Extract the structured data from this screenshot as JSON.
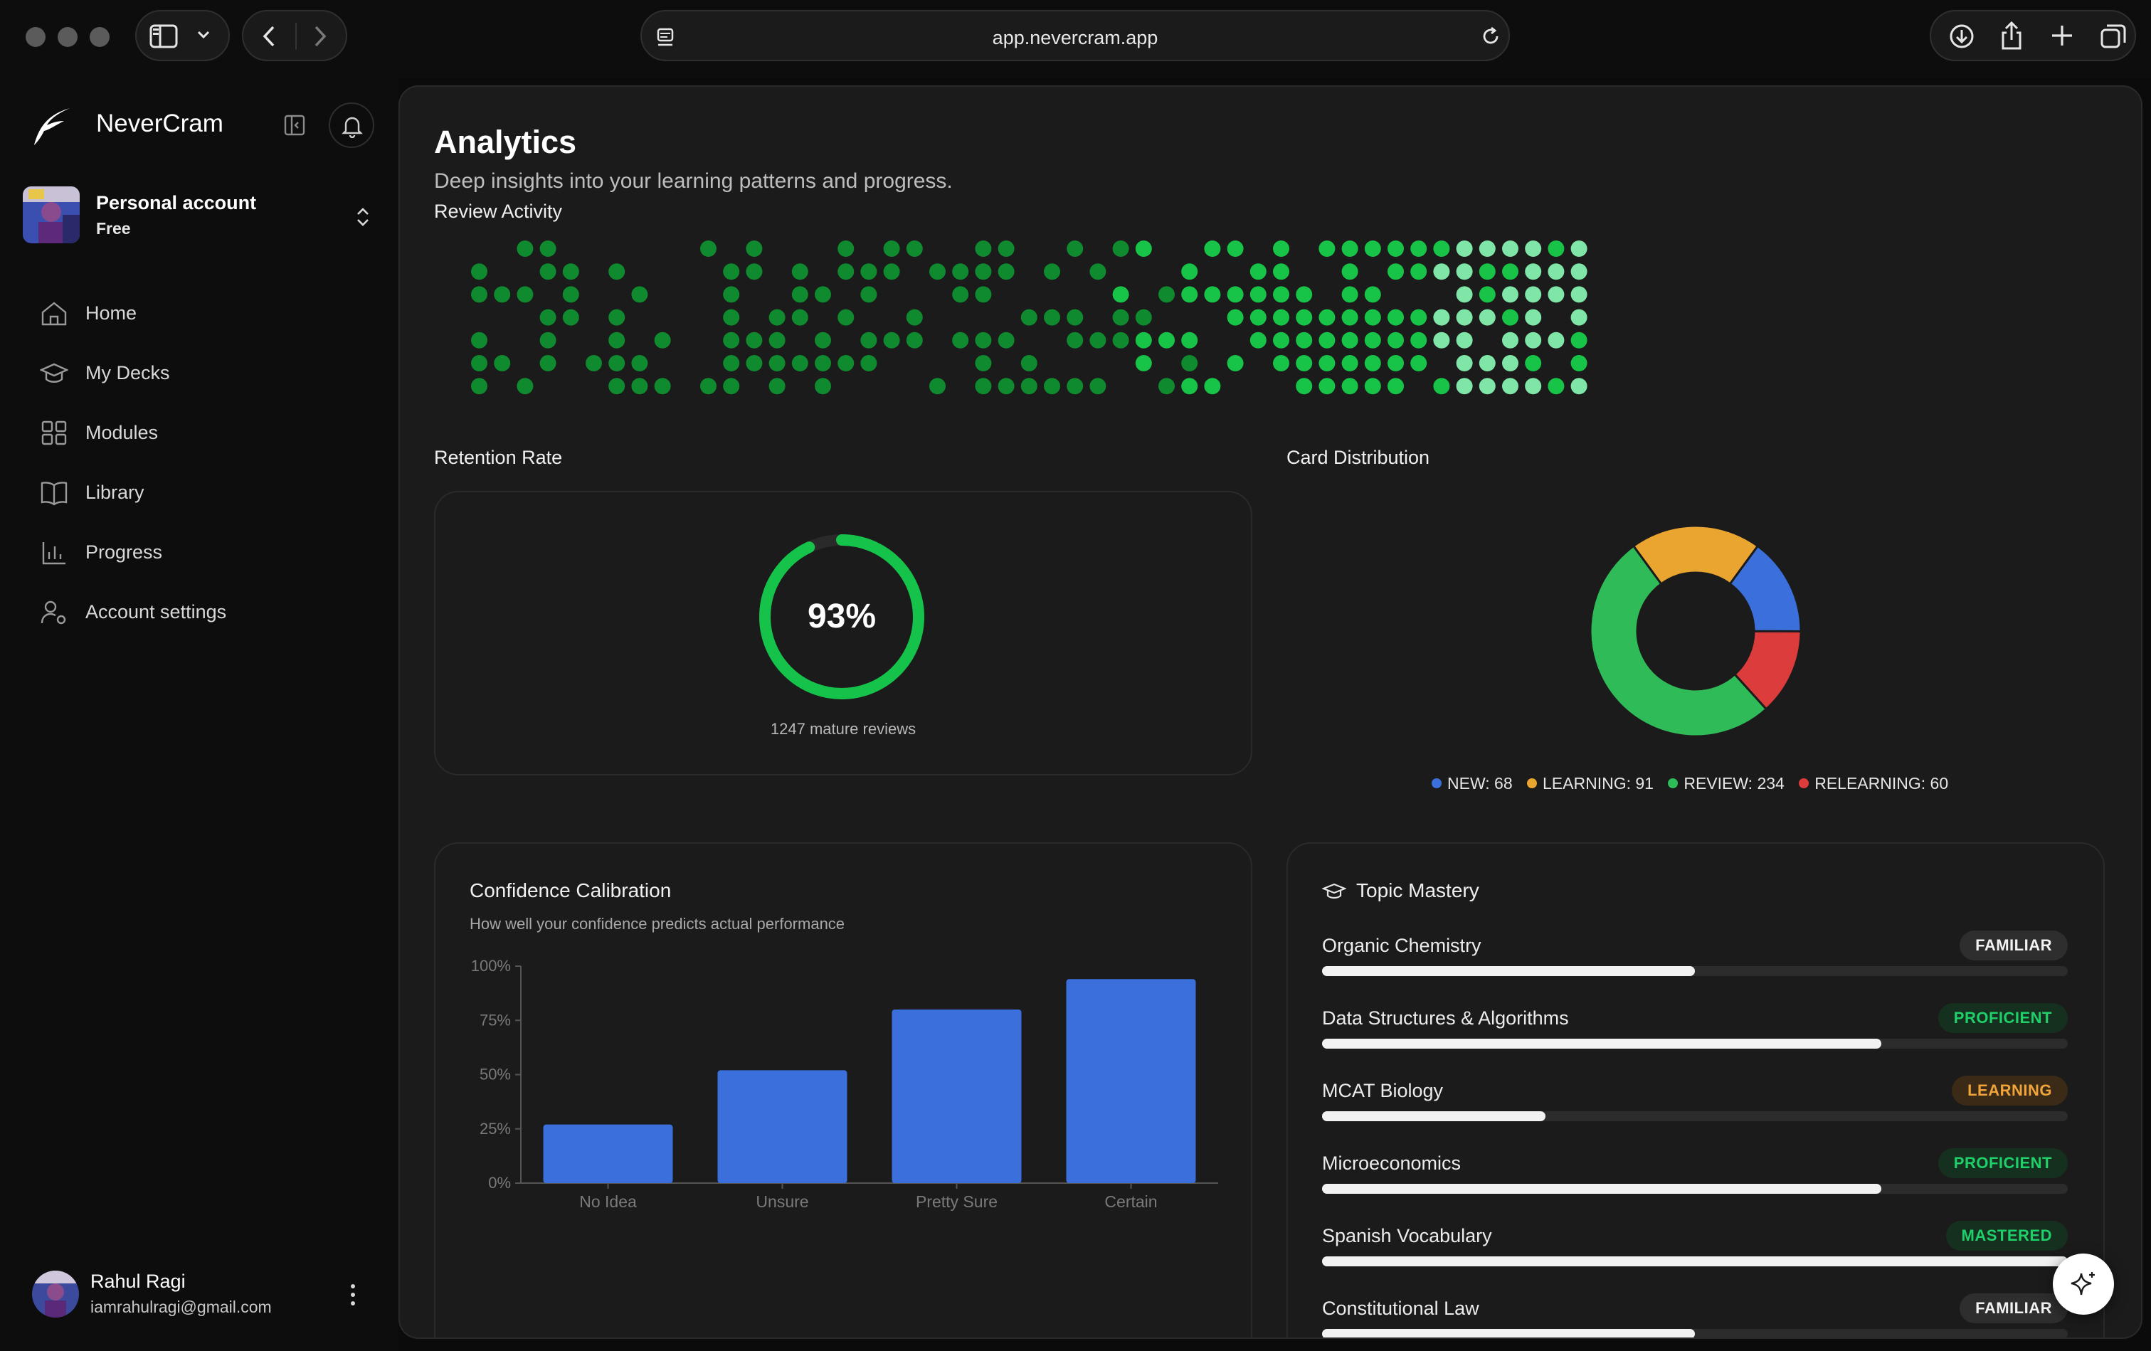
{
  "browser": {
    "url": "app.nevercram.app"
  },
  "sidebar": {
    "brand": "NeverCram",
    "account": {
      "name": "Personal account",
      "plan": "Free"
    },
    "nav": [
      {
        "label": "Home",
        "icon": "home-icon"
      },
      {
        "label": "My Decks",
        "icon": "graduation-cap-icon"
      },
      {
        "label": "Modules",
        "icon": "grid-icon"
      },
      {
        "label": "Library",
        "icon": "book-icon"
      },
      {
        "label": "Progress",
        "icon": "bar-chart-icon"
      },
      {
        "label": "Account settings",
        "icon": "user-settings-icon"
      }
    ],
    "user": {
      "name": "Rahul Ragi",
      "email": "iamrahulragi@gmail.com"
    }
  },
  "page": {
    "title": "Analytics",
    "subtitle": "Deep insights into your learning patterns and progress."
  },
  "review_activity": {
    "label": "Review Activity",
    "colors": [
      "#0f8a2e",
      "#17c447",
      "#7fe6a8"
    ],
    "weeks": [
      "0000000",
      "0000000",
      "0000000",
      "0001011",
      "0000000",
      "0010011",
      "0000110",
      "0001001",
      "1000000",
      "0100000",
      "0000000",
      "0000011",
      "0000000",
      "0101000",
      "0000101",
      "0000100",
      "0101000",
      "0000000",
      "0000011",
      "0000000",
      "0000000",
      "0000000",
      "0000000",
      "0000000",
      "0000011",
      "0001100",
      "0001011",
      "0000000",
      "0000001",
      "0010000",
      "0000001",
      "0001001",
      "0100011",
      "0000001",
      "0111001",
      "0110111",
      "0000001",
      "0001101",
      "0000011",
      "0101001",
      "0000101",
      "0001001",
      "0101001",
      "0100011",
      "0000101",
      "0000001",
      "0000111",
      "0011001",
      "0000000",
      "0011101",
      "0000001",
      "0010011",
      "0001100",
      "0000011",
      "0000001",
      "0000001",
      "0000111",
      "0101001",
      "0001101",
      "0000011",
      "0010101",
      "0101111",
      "0001011",
      "0011111",
      "0000011",
      "0000001",
      "0011101",
      "0011011",
      "0000111",
      "0000011",
      "0011111",
      "0000011",
      "0011011",
      "0000111",
      "0000011",
      "0011011",
      "0111101",
      "0000101",
      "0001011",
      "0001111",
      "0000011",
      "0000101",
      "0001011",
      "0000011",
      "0001011",
      "0001111",
      "0000011",
      "0000111",
      "0000011",
      "0010011",
      "0000111",
      "0010011",
      "0001111",
      "0000111",
      "0001111",
      "0000011",
      "0000111",
      "0001111",
      "0011111",
      "0000001",
      "0001111",
      "0010001",
      "0000001",
      "0000011",
      "0000111",
      "0000011",
      "0000011",
      "0001111",
      "0000011",
      "0000000",
      "0000000",
      "0000000",
      "0000000",
      "0000000",
      "0000000",
      "0000000",
      "0000000",
      "0000000",
      "0000000",
      "0000000",
      "0000000",
      "0000000",
      "0000000",
      "0000000",
      "0000000",
      "0000000",
      "0000000",
      "0000000"
    ],
    "intensity": [
      "1111111",
      "1111111",
      "1111111",
      "1111111",
      "1111111",
      "1111111",
      "1111111",
      "1111111",
      "1111111",
      "1111111",
      "1111111",
      "1111111",
      "1111111",
      "1111111",
      "1111111",
      "1111111",
      "1111111",
      "1111111",
      "1111111",
      "1111111",
      "1111111",
      "1111111",
      "1111111",
      "1111111",
      "1111111",
      "1111111",
      "1111111",
      "1111111",
      "1111111",
      "1111111",
      "1111111",
      "1111111",
      "1111111",
      "1111111",
      "1111111",
      "1111111",
      "1111111",
      "1111111",
      "1111111",
      "1111111",
      "1111111",
      "1111111",
      "1111111",
      "1111111",
      "1111111",
      "1111111",
      "1111111",
      "1111111",
      "1111111",
      "1111111",
      "1111111",
      "1111111",
      "1111111",
      "1111111",
      "1111111",
      "1111111",
      "1111111",
      "1111111",
      "1111111",
      "1111111",
      "1111111",
      "1111111",
      "1111111",
      "1111111",
      "1111111",
      "1111111",
      "1111111",
      "1111111",
      "1111111",
      "1111111",
      "1111111",
      "1111111",
      "1111111",
      "1111111",
      "1111111",
      "1111111",
      "1111111",
      "1111111",
      "1111111",
      "1111111",
      "1111111",
      "1111111",
      "1111111",
      "1111111",
      "1111111",
      "1111111",
      "1111111",
      "1111111",
      "1111111",
      "1111111",
      "1111111",
      "1111111",
      "1111111",
      "1111111",
      "1111111",
      "1111111",
      "1111111",
      "1111111",
      "1111111",
      "1111111",
      "1111111",
      "1111111",
      "1111111",
      "1111111",
      "1111111",
      "1111111",
      "1111111",
      "1111111",
      "1111111",
      "1111111",
      "1111111",
      "1111111",
      "1111111",
      "1111111",
      "1111111",
      "1111111",
      "1111111",
      "1111111",
      "1111111",
      "1111111",
      "1111111",
      "1111111",
      "1111111",
      "1111111",
      "1111111",
      "1111111",
      "1111111",
      "1111111"
    ]
  },
  "retention": {
    "label": "Retention Rate",
    "value": 93,
    "value_text": "93%",
    "caption": "1247 mature reviews",
    "color": "#16c34a"
  },
  "distribution": {
    "label": "Card Distribution",
    "items": [
      {
        "name": "NEW",
        "value": 68,
        "color": "#3b6fdc",
        "text": "NEW: 68"
      },
      {
        "name": "LEARNING",
        "value": 91,
        "color": "#eaa531",
        "text": "LEARNING: 91"
      },
      {
        "name": "REVIEW",
        "value": 234,
        "color": "#2fbb57",
        "text": "REVIEW: 234"
      },
      {
        "name": "RELEARNING",
        "value": 60,
        "color": "#dc3c3c",
        "text": "RELEARNING: 60"
      }
    ]
  },
  "calibration": {
    "title": "Confidence Calibration",
    "subtitle": "How well your confidence predicts actual performance",
    "chart_data": {
      "type": "bar",
      "categories": [
        "No Idea",
        "Unsure",
        "Pretty Sure",
        "Certain"
      ],
      "values": [
        27,
        52,
        80,
        94
      ],
      "ylim": [
        0,
        100
      ],
      "yticks": [
        "0%",
        "25%",
        "50%",
        "75%",
        "100%"
      ],
      "color": "#3a6fdc"
    }
  },
  "topic_mastery": {
    "title": "Topic Mastery",
    "topics": [
      {
        "name": "Organic Chemistry",
        "badge": "FAMILIAR",
        "progress": 0.5,
        "badge_color": "#f2f2f2",
        "badge_bg": "#2e2e2e"
      },
      {
        "name": "Data Structures & Algorithms",
        "badge": "PROFICIENT",
        "progress": 0.75,
        "badge_color": "#1fcf6a",
        "badge_bg": "#16301f"
      },
      {
        "name": "MCAT Biology",
        "badge": "LEARNING",
        "progress": 0.3,
        "badge_color": "#f0a43a",
        "badge_bg": "#3a2a16"
      },
      {
        "name": "Microeconomics",
        "badge": "PROFICIENT",
        "progress": 0.75,
        "badge_color": "#1fcf6a",
        "badge_bg": "#16301f"
      },
      {
        "name": "Spanish Vocabulary",
        "badge": "MASTERED",
        "progress": 1.0,
        "badge_color": "#1fcf6a",
        "badge_bg": "#16301f"
      },
      {
        "name": "Constitutional Law",
        "badge": "FAMILIAR",
        "progress": 0.5,
        "badge_color": "#f2f2f2",
        "badge_bg": "#2e2e2e"
      }
    ]
  }
}
